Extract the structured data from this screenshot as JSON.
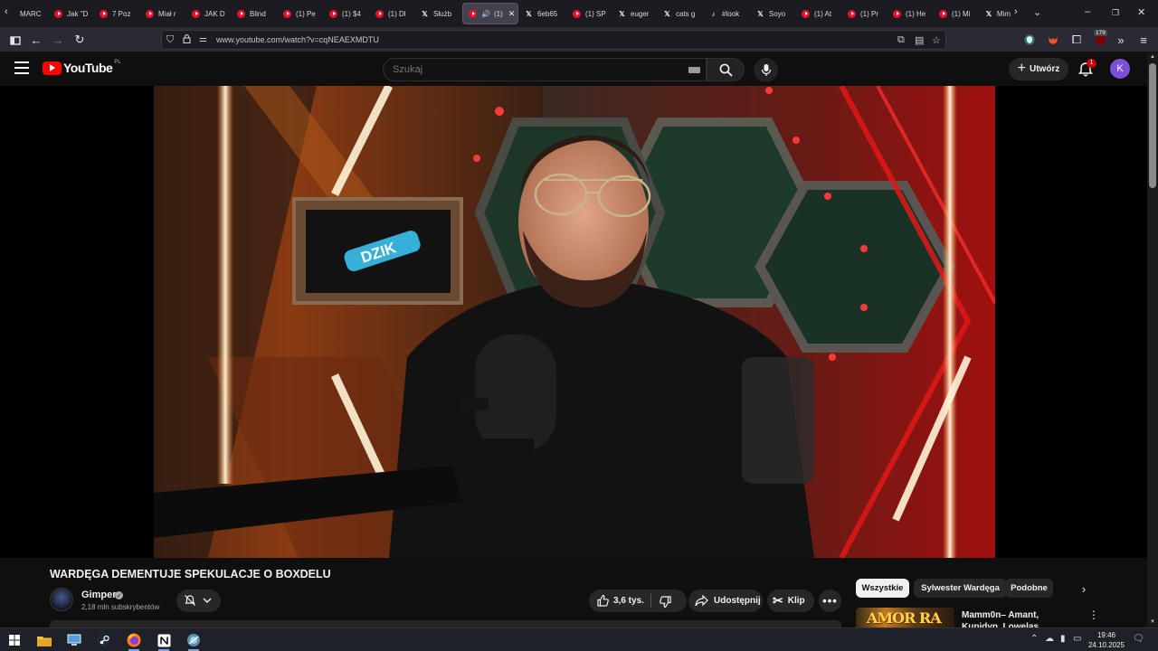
{
  "browser": {
    "tabs": [
      {
        "label": "MARC",
        "favicon": "mail-icon"
      },
      {
        "label": "Jak \"D",
        "favicon": "youtube-icon"
      },
      {
        "label": "7 Poz",
        "favicon": "youtube-icon"
      },
      {
        "label": "Miał r",
        "favicon": "youtube-icon"
      },
      {
        "label": "JAK D",
        "favicon": "youtube-icon"
      },
      {
        "label": "Blind",
        "favicon": "youtube-icon"
      },
      {
        "label": "(1) Pe",
        "favicon": "youtube-icon"
      },
      {
        "label": "(1) $4",
        "favicon": "youtube-icon"
      },
      {
        "label": "(1) Dl",
        "favicon": "youtube-icon"
      },
      {
        "label": "Służb",
        "favicon": "x-icon"
      },
      {
        "label": "(1)",
        "favicon": "youtube-icon",
        "active": true
      },
      {
        "label": "6eb65",
        "favicon": "x-box-icon"
      },
      {
        "label": "(1) SP",
        "favicon": "youtube-icon"
      },
      {
        "label": "euger",
        "favicon": "x-icon"
      },
      {
        "label": "cats g",
        "favicon": "x-icon"
      },
      {
        "label": "#look",
        "favicon": "tiktok-icon"
      },
      {
        "label": "Soyo",
        "favicon": "x-icon"
      },
      {
        "label": "(1) At",
        "favicon": "youtube-icon"
      },
      {
        "label": "(1) Pr",
        "favicon": "youtube-icon"
      },
      {
        "label": "(1) He",
        "favicon": "youtube-icon"
      },
      {
        "label": "(1) Mi",
        "favicon": "youtube-icon"
      },
      {
        "label": "Mim",
        "favicon": "x-icon"
      }
    ],
    "url": "www.youtube.com/watch?v=cqNEAEXMDTU",
    "extension_badge": "179"
  },
  "youtube": {
    "logo_text": "YouTube",
    "country_code": "PL",
    "search_placeholder": "Szukaj",
    "create_label": "Utwórz",
    "notification_count": "1",
    "avatar_letter": "K"
  },
  "video": {
    "title": "WARDĘGA DEMENTUJE SPEKULACJE O BOXDELU",
    "channel_name": "Gimper",
    "subscribers": "2,18 mln subskrybentów",
    "likes": "3,6 tys.",
    "share_label": "Udostępnij",
    "clip_label": "Klip",
    "scene_sign_text": "DZIK"
  },
  "sidebar": {
    "chips": [
      "Wszystkie",
      "Sylwester Wardęga",
      "Podobne"
    ],
    "recommendation": {
      "title": "Mamm0n– Amant, Kupidyn, Lowelas",
      "thumb_text": "AMOR RA"
    }
  },
  "taskbar": {
    "time": "19:46",
    "date": "24.10.2025"
  },
  "colors": {
    "youtube_red": "#ff0000",
    "avatar_purple": "#7b4fd8",
    "background": "#0f0f0f"
  }
}
